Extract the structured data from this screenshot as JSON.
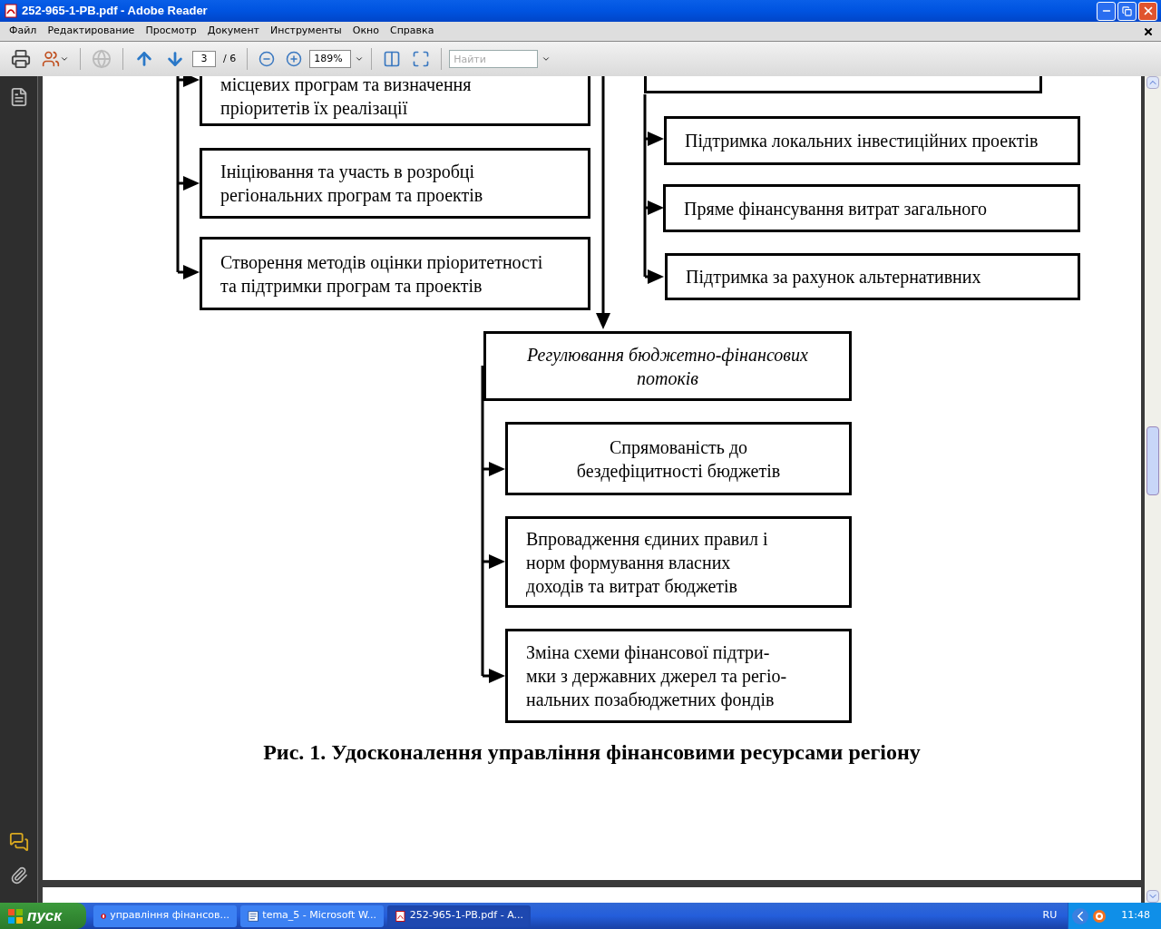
{
  "window": {
    "title": "252-965-1-PB.pdf - Adobe Reader"
  },
  "menu": [
    "Файл",
    "Редактирование",
    "Просмотр",
    "Документ",
    "Инструменты",
    "Окно",
    "Справка"
  ],
  "toolbar": {
    "page": "3",
    "page_total": "/ 6",
    "zoom": "189%",
    "search": {
      "placeholder": "Найти"
    }
  },
  "diagram": {
    "nodes": [
      {
        "kind": "item",
        "centered": false,
        "lines": [
          "місцевих програм та визначення",
          "пріоритетів їх реалізації"
        ]
      },
      {
        "kind": "item",
        "centered": false,
        "lines": [
          "Ініціювання та участь в розробці",
          "регіональних програм та проектів"
        ]
      },
      {
        "kind": "item",
        "centered": false,
        "lines": [
          "Створення методів оцінки пріоритетності",
          "та підтримки програм та проектів"
        ]
      },
      {
        "kind": "heading"
      },
      {
        "kind": "item",
        "centered": false,
        "lines": [
          "Підтримка локальних інвестиційних проектів"
        ]
      },
      {
        "kind": "item",
        "centered": false,
        "lines": [
          "Пряме фінансування витрат загального"
        ]
      },
      {
        "kind": "item",
        "centered": false,
        "lines": [
          "Підтримка за рахунок альтернативних"
        ]
      },
      {
        "kind": "heading",
        "centered": true,
        "lines": [
          "Регулювання бюджетно-фінансових",
          "потоків"
        ]
      },
      {
        "kind": "item",
        "centered": true,
        "lines": [
          "Спрямованість до",
          "бездефіцитності бюджетів"
        ]
      },
      {
        "kind": "item",
        "centered": false,
        "lines": [
          "Впровадження єдиних правил і",
          "норм формування власних",
          "доходів та витрат бюджетів"
        ]
      },
      {
        "kind": "item",
        "centered": false,
        "lines": [
          "Зміна схеми фінансової підтри-",
          "мки з державних джерел та регіо-",
          "нальних позабюджетних фондів"
        ]
      }
    ],
    "caption": "Рис. 1. Удосконалення управління фінансовими ресурсами регіону"
  },
  "taskbar": {
    "start": "пуск",
    "tasks": [
      {
        "label": "управління фінансов...",
        "kind": "browser",
        "selected": false
      },
      {
        "label": "tema_5 - Microsoft W...",
        "kind": "word",
        "selected": false
      },
      {
        "label": "252-965-1-PB.pdf - A...",
        "kind": "pdf",
        "selected": true
      }
    ],
    "language": "RU",
    "clock": "11:48"
  }
}
